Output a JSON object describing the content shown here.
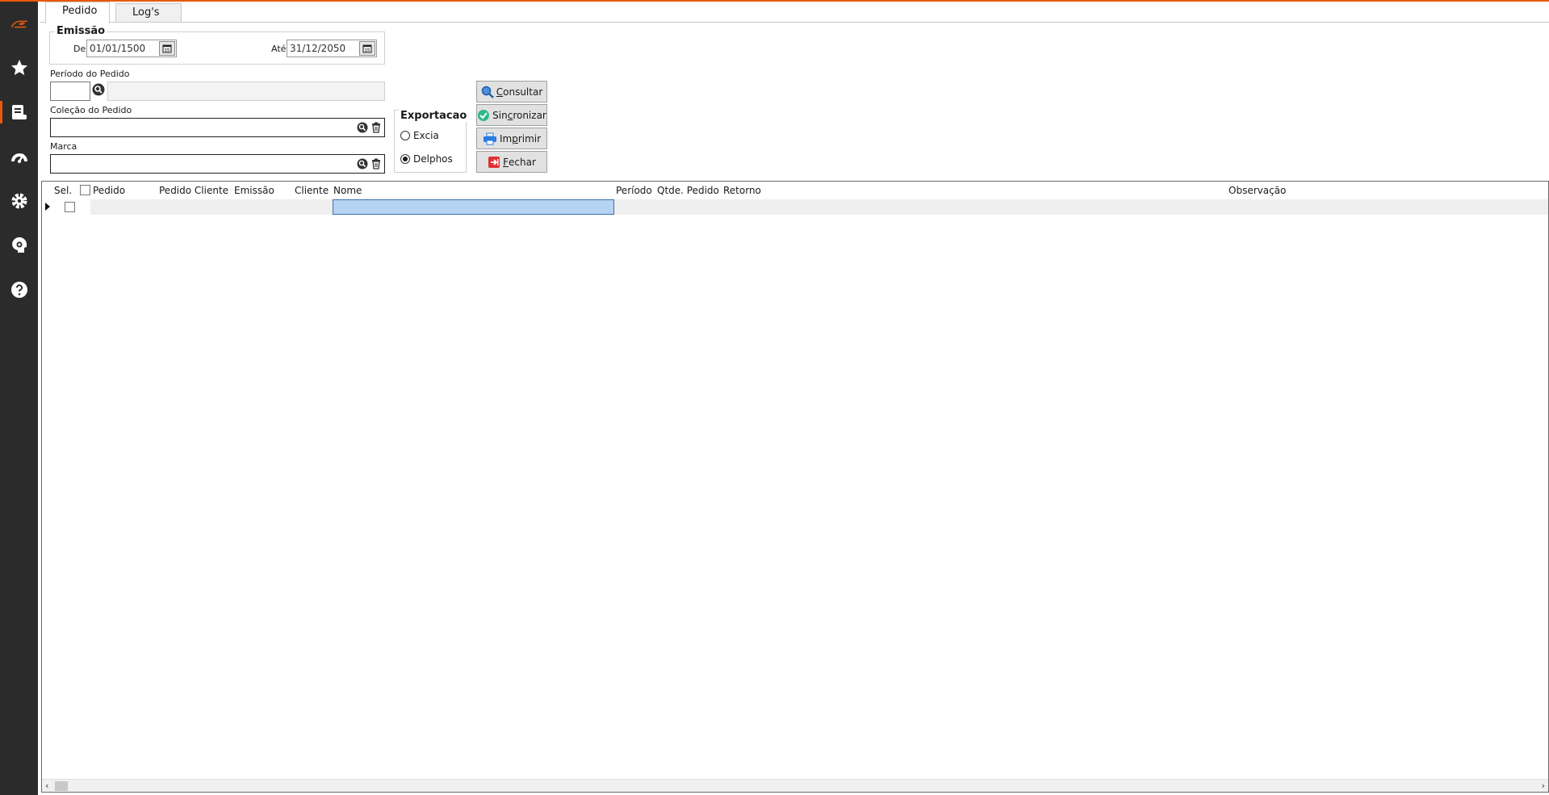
{
  "colors": {
    "accent": "#e8590c",
    "sidebar": "#2b2b2b"
  },
  "sidebar": {
    "items": [
      {
        "icon": "logo-icon"
      },
      {
        "icon": "star-icon"
      },
      {
        "icon": "document-icon"
      },
      {
        "icon": "dashboard-icon"
      },
      {
        "icon": "gear-icon"
      },
      {
        "icon": "settings-profile-icon"
      },
      {
        "icon": "help-icon"
      }
    ]
  },
  "tabs": [
    {
      "label": "Pedido"
    },
    {
      "label": "Log's"
    }
  ],
  "emissao": {
    "title": "Emissão",
    "de_label": "De",
    "de_value": "01/01/1500",
    "ate_label": "Até",
    "ate_value": "31/12/2050"
  },
  "periodo": {
    "label": "Período do Pedido",
    "code": "",
    "desc": ""
  },
  "colecao": {
    "label": "Coleção do Pedido",
    "value": ""
  },
  "marca": {
    "label": "Marca",
    "value": ""
  },
  "exportacao": {
    "title": "Exportacao",
    "options": [
      {
        "label": "Excia",
        "selected": false
      },
      {
        "label": "Delphos",
        "selected": true
      }
    ]
  },
  "actions": {
    "consultar": {
      "first": "C",
      "rest": "onsultar"
    },
    "sincronizar": {
      "pre": "Sin",
      "u": "c",
      "rest": "ronizar"
    },
    "imprimir": {
      "pre": "Im",
      "u": "p",
      "rest": "rimir"
    },
    "fechar": {
      "first": "F",
      "rest": "echar"
    }
  },
  "grid": {
    "columns": [
      "Sel.",
      "Pedido",
      "Pedido Cliente",
      "Emissão",
      "Cliente",
      "Nome",
      "Período",
      "Qtde. Pedido",
      "Retorno",
      "Observação"
    ],
    "rows": [
      {
        "selected": false
      }
    ]
  }
}
